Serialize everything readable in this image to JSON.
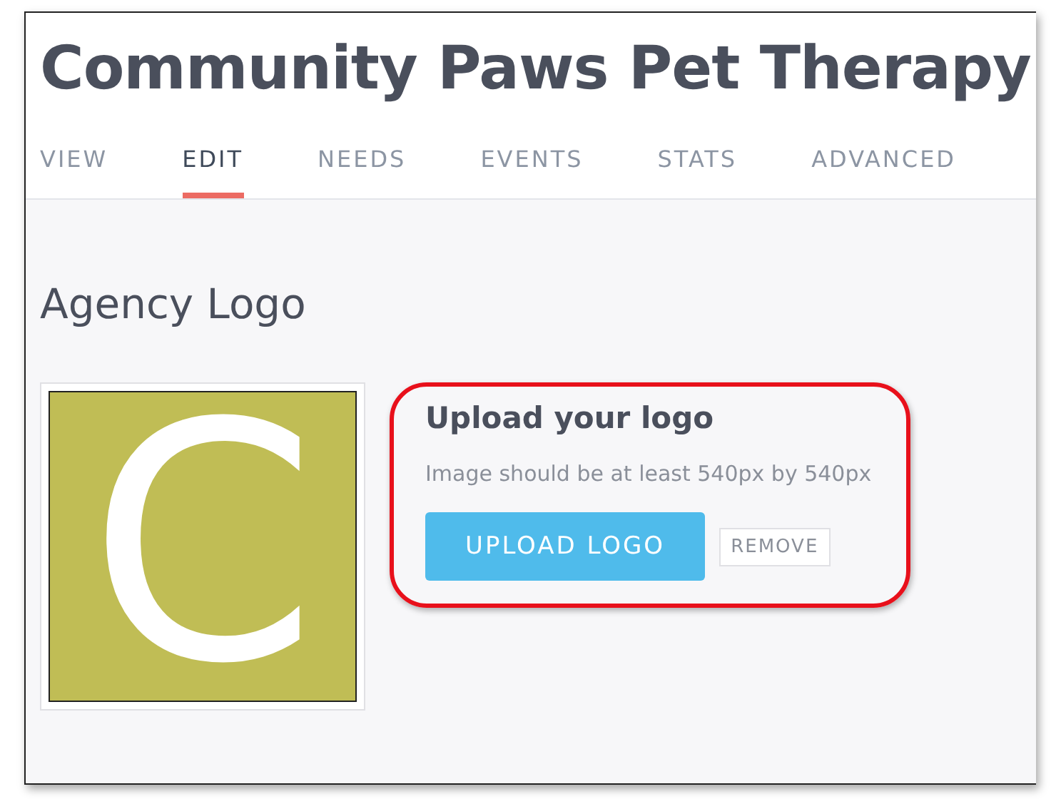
{
  "title": "Community Paws Pet Therapy",
  "tabs": [
    {
      "label": "VIEW",
      "selected": false
    },
    {
      "label": "EDIT",
      "selected": true
    },
    {
      "label": "NEEDS",
      "selected": false
    },
    {
      "label": "EVENTS",
      "selected": false
    },
    {
      "label": "STATS",
      "selected": false
    },
    {
      "label": "ADVANCED",
      "selected": false
    }
  ],
  "section": {
    "heading": "Agency Logo",
    "logo": {
      "letter": "C",
      "color": "#c0bd55"
    },
    "upload": {
      "heading": "Upload your logo",
      "hint": "Image should be at least 540px by 540px",
      "buttons": [
        {
          "label": "UPLOAD LOGO",
          "kind": "primary"
        },
        {
          "label": "REMOVE",
          "kind": "secondary"
        }
      ]
    }
  }
}
